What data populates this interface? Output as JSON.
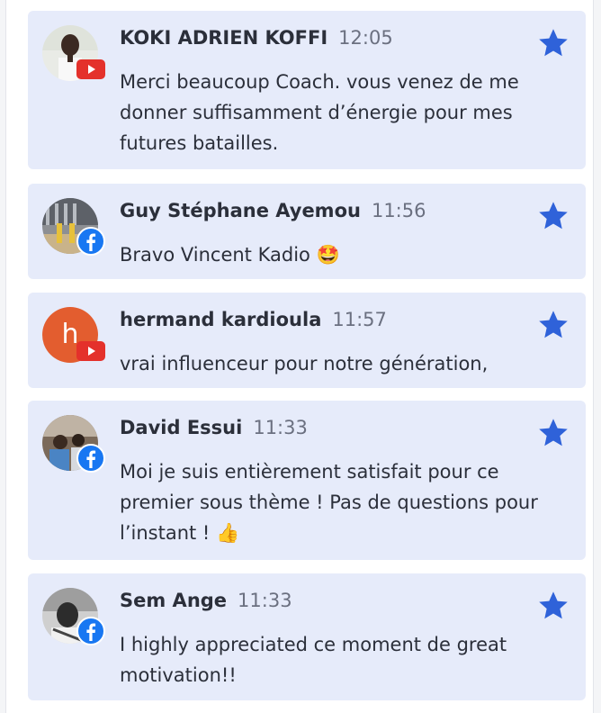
{
  "colors": {
    "card_bg": "#e6ebfa",
    "star": "#2f62d9",
    "youtube": "#e4312b",
    "facebook": "#1877f2",
    "letter_avatar": "#e35d2f"
  },
  "comments": [
    {
      "author": "KOKI ADRIEN KOFFI",
      "time": "12:05",
      "platform": "youtube-icon",
      "text": "Merci beaucoup Coach. vous venez de me donner suffisamment d’énergie pour mes futures batailles.",
      "avatar": "photo"
    },
    {
      "author": "Guy Stéphane Ayemou",
      "time": "11:56",
      "platform": "facebook-icon",
      "text": "Bravo Vincent Kadio 🤩",
      "avatar": "photo"
    },
    {
      "author": "hermand kardioula",
      "time": "11:57",
      "platform": "youtube-icon",
      "text": "vrai influenceur pour notre génération,",
      "avatar": "letter",
      "avatar_letter": "h"
    },
    {
      "author": "David Essui",
      "time": "11:33",
      "platform": "facebook-icon",
      "text": "Moi je suis entièrement satisfait pour ce premier sous thème ! Pas de questions pour l’instant ! 👍",
      "avatar": "photo"
    },
    {
      "author": "Sem Ange",
      "time": "11:33",
      "platform": "facebook-icon",
      "text": "I highly appreciated ce moment de great motivation!!",
      "avatar": "photo"
    }
  ]
}
